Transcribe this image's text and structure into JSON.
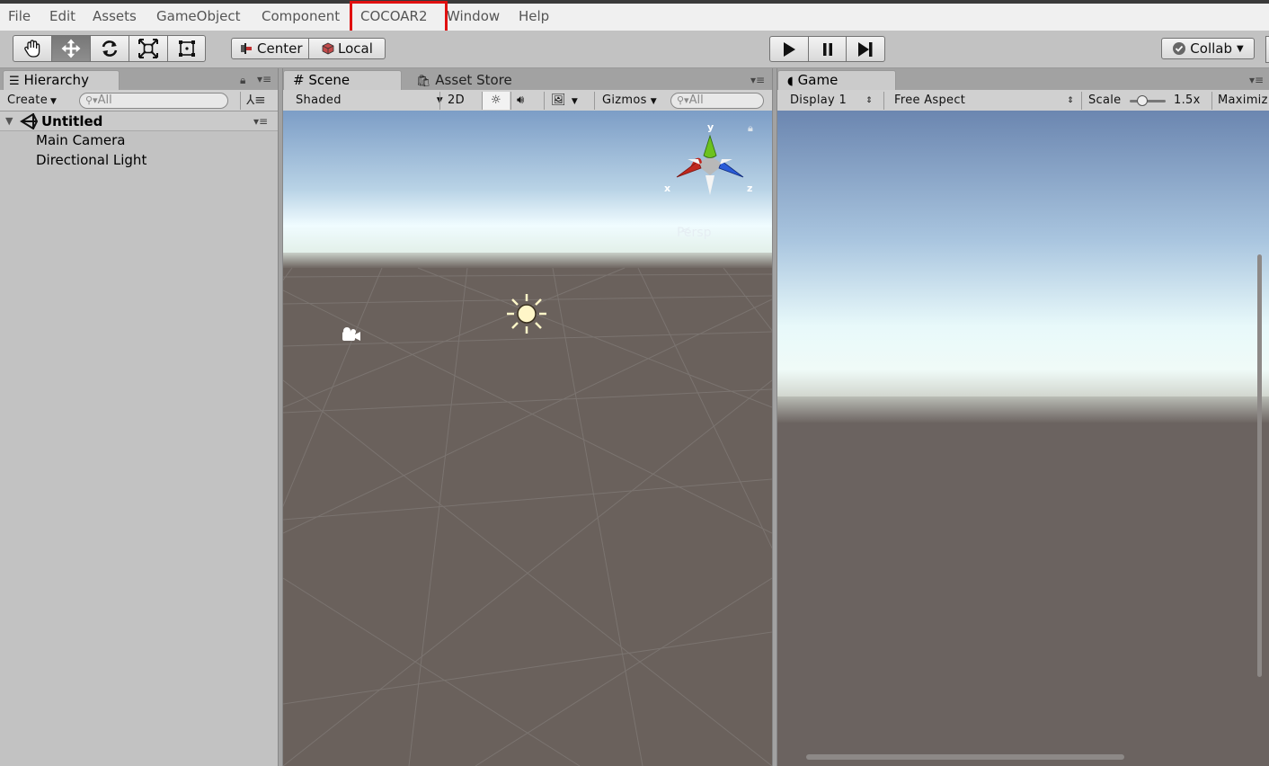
{
  "menu": {
    "items": [
      "File",
      "Edit",
      "Assets",
      "GameObject",
      "Component",
      "COCOAR2",
      "Window",
      "Help"
    ]
  },
  "toolbar": {
    "transform_tools": [
      "hand-tool",
      "move-tool",
      "rotate-tool",
      "scale-tool",
      "rect-tool"
    ],
    "pivot_label": "Center",
    "space_label": "Local",
    "collab_label": "Collab"
  },
  "hierarchy": {
    "tab_label": "Hierarchy",
    "create_label": "Create",
    "search_placeholder": "All",
    "scene_name": "Untitled",
    "items": [
      "Main Camera",
      "Directional Light"
    ]
  },
  "scene": {
    "tab_label": "Scene",
    "asset_store_label": "Asset Store",
    "shading_mode": "Shaded",
    "mode_2d_label": "2D",
    "gizmos_label": "Gizmos",
    "search_placeholder": "All",
    "projection_label": "Persp",
    "axis_labels": {
      "x": "x",
      "y": "y",
      "z": "z"
    }
  },
  "game": {
    "tab_label": "Game",
    "display_label": "Display 1",
    "aspect_label": "Free Aspect",
    "scale_label": "Scale",
    "scale_value": "1.5x",
    "maximize_label": "Maximiz"
  },
  "colors": {
    "highlight_box": "#e01010",
    "axis_x": "#c0281e",
    "axis_y": "#6cc21e",
    "axis_z": "#2a5cd8",
    "ground": "#6a615c"
  }
}
